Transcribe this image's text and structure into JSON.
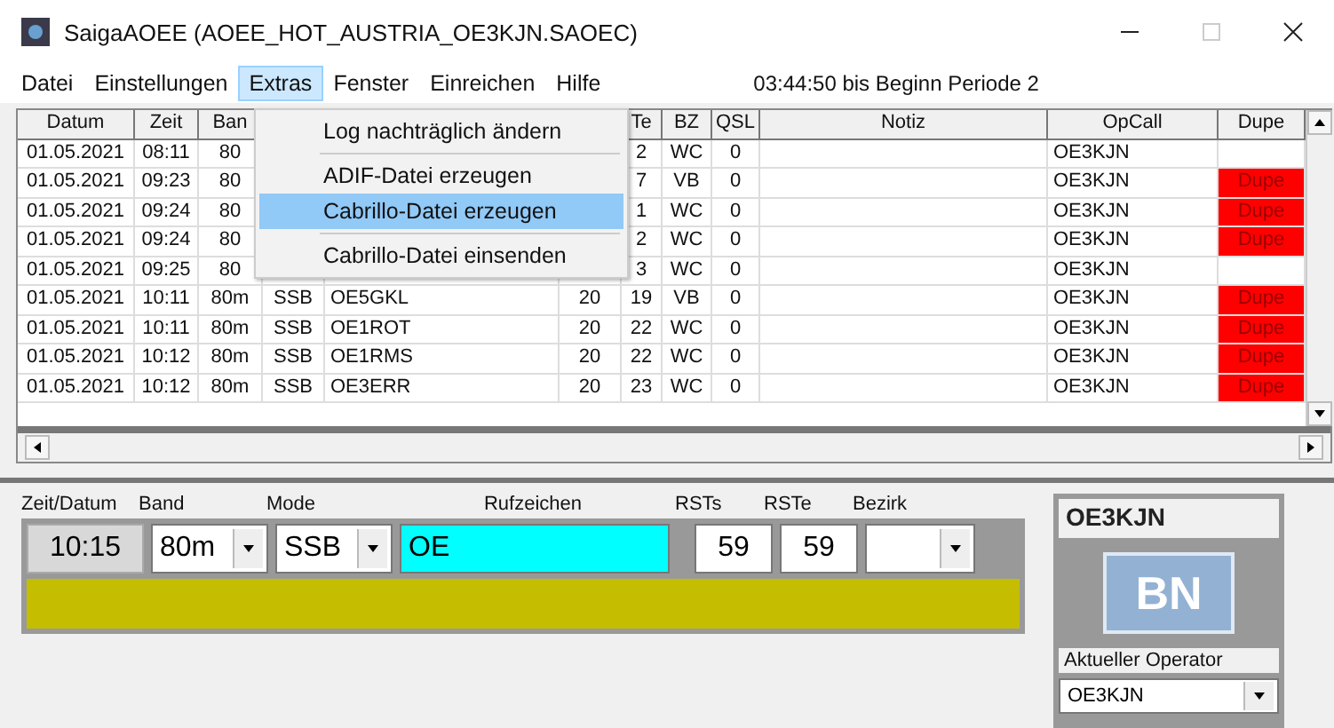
{
  "window": {
    "title": "SaigaAOEE (AOEE_HOT_AUSTRIA_OE3KJN.SAOEC)"
  },
  "menu_bar": [
    {
      "label": "Datei",
      "selected": false
    },
    {
      "label": "Einstellungen",
      "selected": false
    },
    {
      "label": "Extras",
      "selected": true
    },
    {
      "label": "Fenster",
      "selected": false
    },
    {
      "label": "Einreichen",
      "selected": false
    },
    {
      "label": "Hilfe",
      "selected": false
    }
  ],
  "countdown": "03:44:50 bis Beginn Periode 2",
  "menu": [
    {
      "kind": "item",
      "label": "Log nachträglich ändern",
      "selected": false
    },
    {
      "kind": "separator"
    },
    {
      "kind": "item",
      "label": "ADIF-Datei erzeugen",
      "selected": false
    },
    {
      "kind": "item",
      "label": "Cabrillo-Datei erzeugen",
      "selected": true
    },
    {
      "kind": "separator"
    },
    {
      "kind": "item",
      "label": "Cabrillo-Datei einsenden",
      "selected": false
    }
  ],
  "table": {
    "columns": {
      "datum": "Datum",
      "zeit": "Zeit",
      "band": "Ban",
      "rste": "Te",
      "bz": "BZ",
      "qsl": "QSL",
      "notiz": "Notiz",
      "opcall": "OpCall",
      "dupe": "Dupe"
    },
    "rows": [
      {
        "datum": "01.05.2021",
        "zeit": "08:11",
        "band": "80",
        "rste": "2",
        "bz": "WC",
        "qsl": "0",
        "opcall": "OE3KJN"
      },
      {
        "datum": "01.05.2021",
        "zeit": "09:23",
        "band": "80",
        "rste": "7",
        "bz": "VB",
        "qsl": "0",
        "opcall": "OE3KJN",
        "dupe": "Dupe"
      },
      {
        "datum": "01.05.2021",
        "zeit": "09:24",
        "band": "80",
        "rste": "1",
        "bz": "WC",
        "qsl": "0",
        "opcall": "OE3KJN",
        "dupe": "Dupe"
      },
      {
        "datum": "01.05.2021",
        "zeit": "09:24",
        "band": "80",
        "rste": "2",
        "bz": "WC",
        "qsl": "0",
        "opcall": "OE3KJN",
        "dupe": "Dupe"
      },
      {
        "datum": "01.05.2021",
        "zeit": "09:25",
        "band": "80",
        "rste": "3",
        "bz": "WC",
        "qsl": "0",
        "opcall": "OE3KJN"
      },
      {
        "datum": "01.05.2021",
        "zeit": "10:11",
        "band": "80m",
        "mode": "SSB",
        "call": "OE5GKL",
        "rsts": "20",
        "rste": "19",
        "bz": "VB",
        "qsl": "0",
        "opcall": "OE3KJN",
        "dupe": "Dupe"
      },
      {
        "datum": "01.05.2021",
        "zeit": "10:11",
        "band": "80m",
        "mode": "SSB",
        "call": "OE1ROT",
        "rsts": "20",
        "rste": "22",
        "bz": "WC",
        "qsl": "0",
        "opcall": "OE3KJN",
        "dupe": "Dupe"
      },
      {
        "datum": "01.05.2021",
        "zeit": "10:12",
        "band": "80m",
        "mode": "SSB",
        "call": "OE1RMS",
        "rsts": "20",
        "rste": "22",
        "bz": "WC",
        "qsl": "0",
        "opcall": "OE3KJN",
        "dupe": "Dupe"
      },
      {
        "datum": "01.05.2021",
        "zeit": "10:12",
        "band": "80m",
        "mode": "SSB",
        "call": "OE3ERR",
        "rsts": "20",
        "rste": "23",
        "bz": "WC",
        "qsl": "0",
        "opcall": "OE3KJN",
        "dupe": "Dupe"
      }
    ]
  },
  "entry": {
    "labels": [
      "Zeit/Datum",
      "Band",
      "Mode",
      "Rufzeichen",
      "RSTs",
      "RSTe",
      "Bezirk"
    ],
    "time": "10:15",
    "band": "80m",
    "mode": "SSB",
    "call": "OE",
    "rsts": "59",
    "rste": "59"
  },
  "operator": {
    "title": "OE3KJN",
    "button": "BN",
    "label": "Aktueller Operator",
    "value": "OE3KJN"
  }
}
